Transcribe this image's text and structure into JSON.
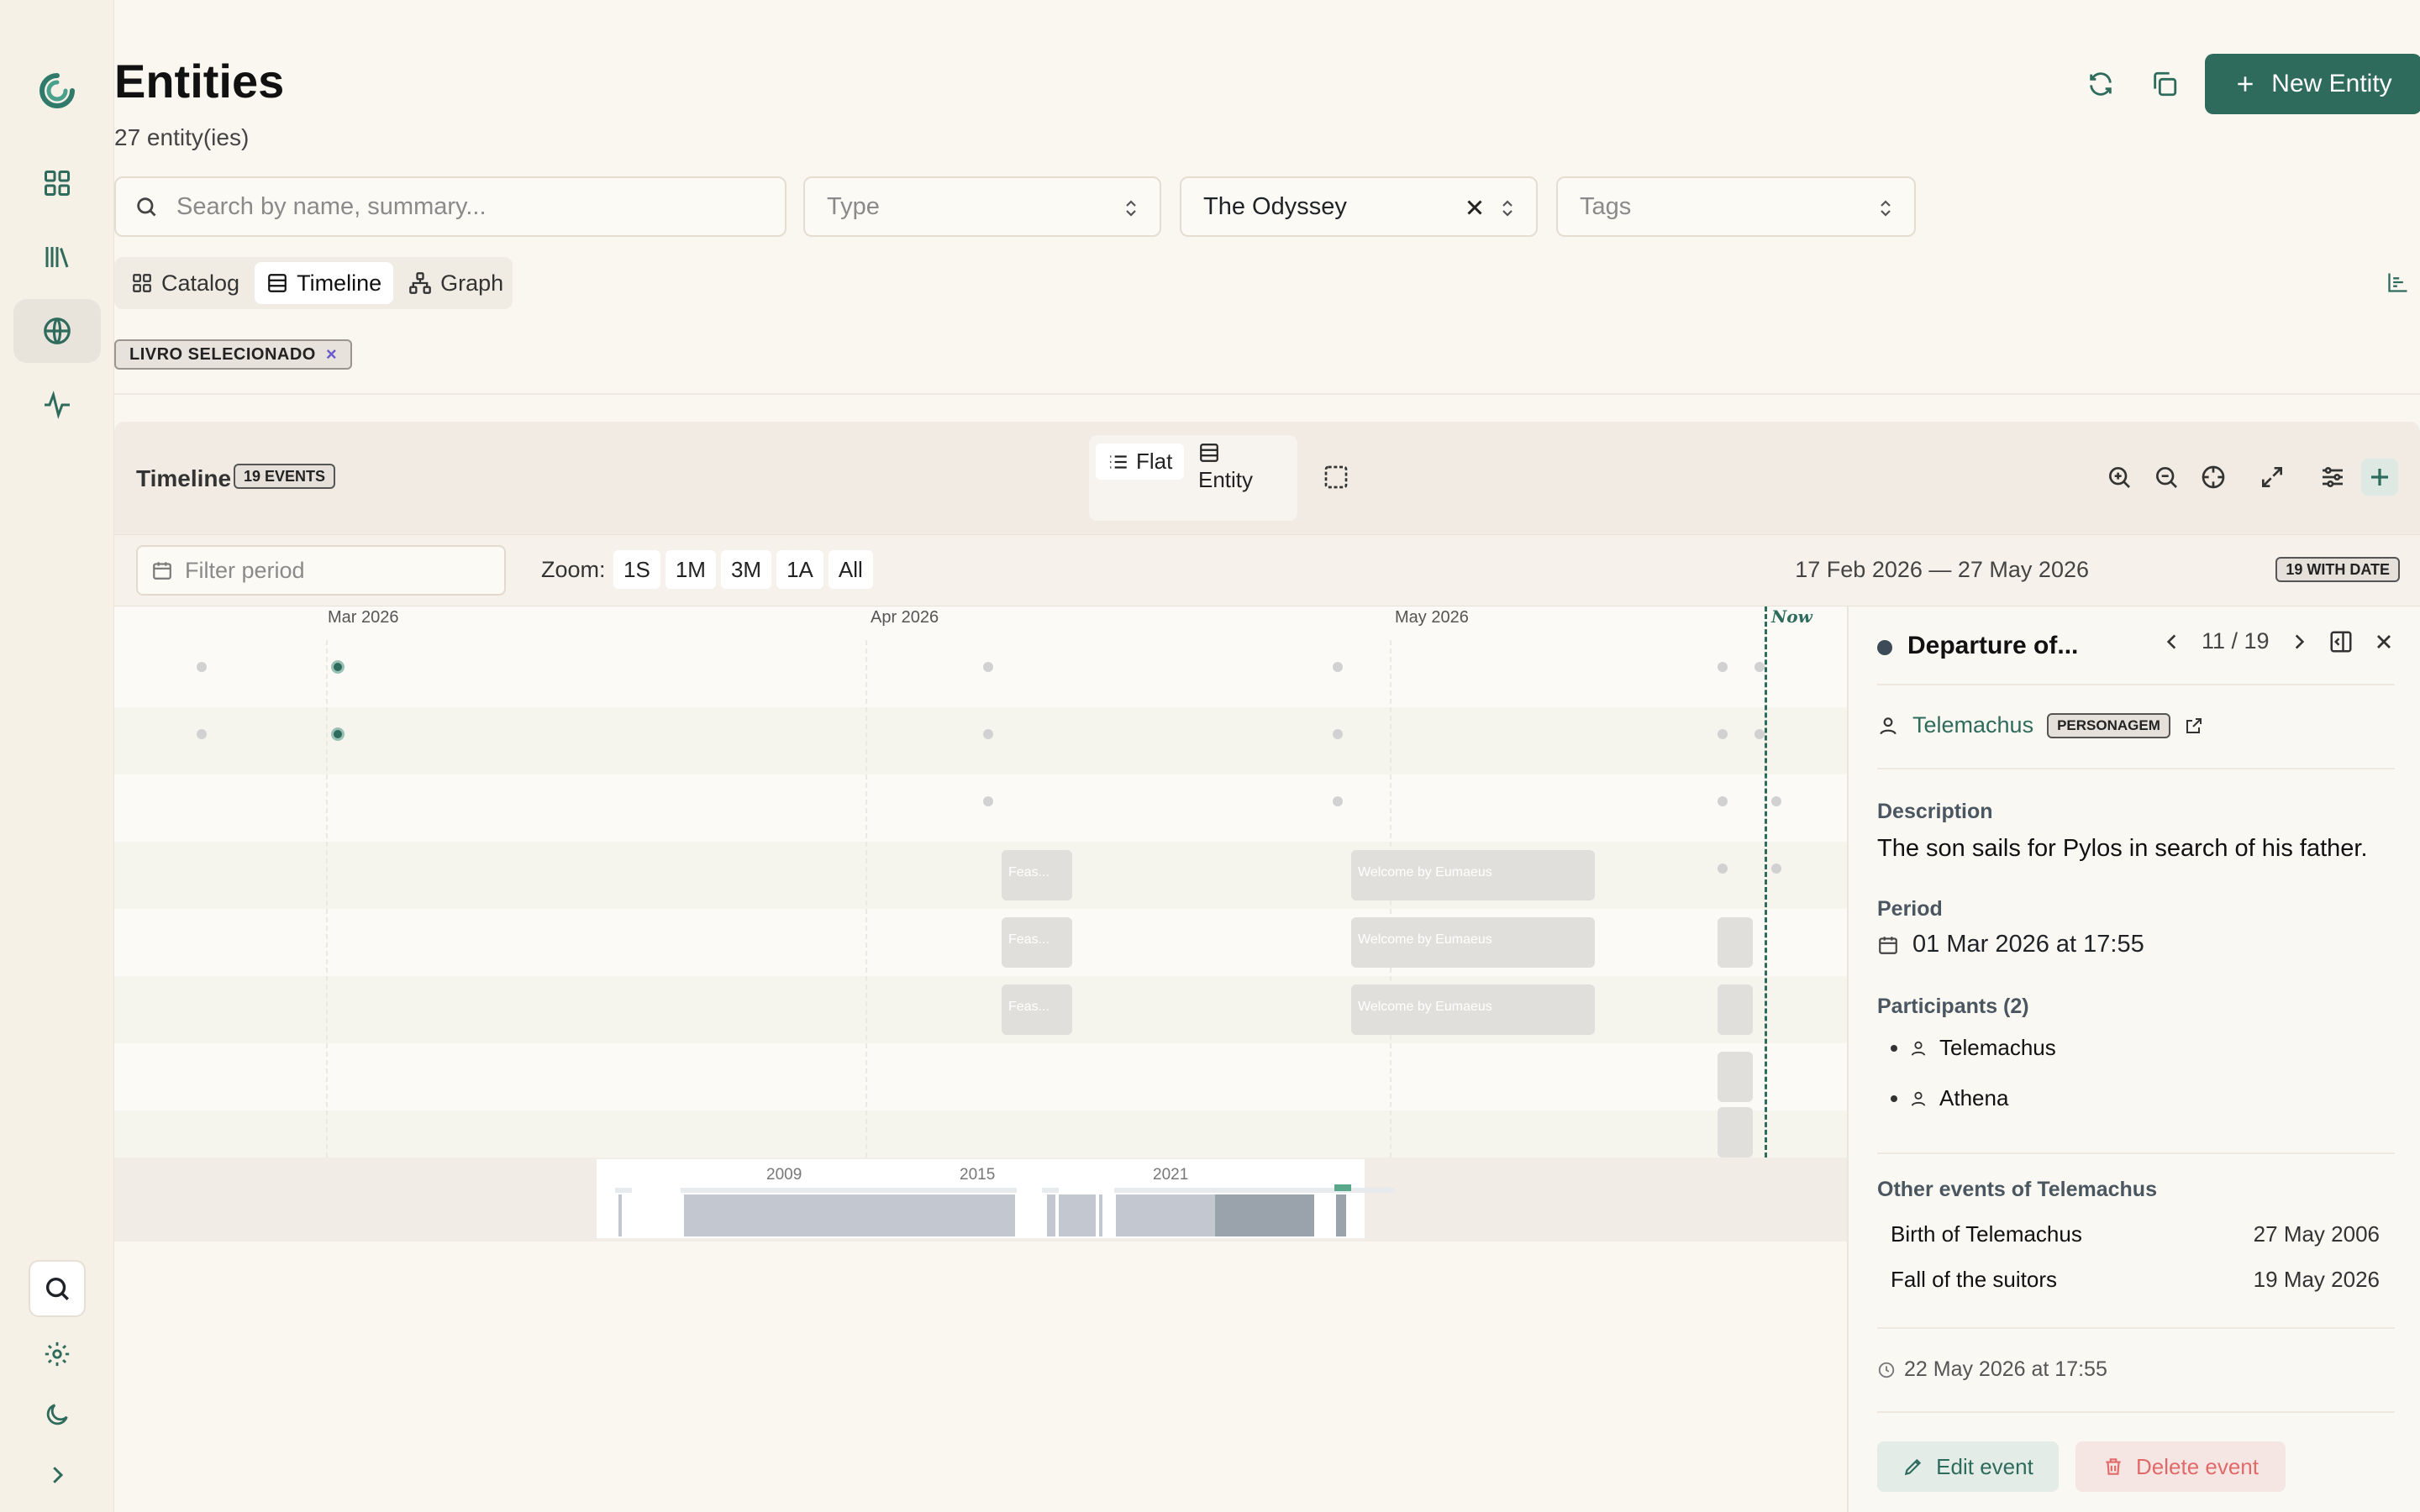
{
  "header": {
    "title": "Entities",
    "count": "27 entity(ies)",
    "new_entity_label": "New Entity"
  },
  "filters": {
    "search_placeholder": "Search by name, summary...",
    "type_placeholder": "Type",
    "book_value": "The Odyssey",
    "tags_placeholder": "Tags"
  },
  "view_tabs": [
    {
      "label": "Catalog",
      "icon": "grid-icon"
    },
    {
      "label": "Timeline",
      "icon": "list-icon",
      "active": true
    },
    {
      "label": "Graph",
      "icon": "graph-icon"
    }
  ],
  "chip": {
    "label": "LIVRO SELECIONADO"
  },
  "timeline": {
    "title": "Timeline",
    "events_badge": "19 EVENTS",
    "mode_flat": "Flat",
    "mode_entity": "Entity",
    "filter_placeholder": "Filter period",
    "zoom_label": "Zoom:",
    "zoom_options": [
      "1S",
      "1M",
      "3M",
      "1A",
      "All"
    ],
    "range": "17 Feb 2026 — 27 May 2026",
    "with_date_badge": "19 WITH DATE",
    "months": [
      "Mar 2026",
      "Apr 2026",
      "May 2026"
    ],
    "now_label": "Now",
    "event_short": "Feas...",
    "event_long": "Welcome by Eumaeus",
    "minimap_years": [
      "2009",
      "2015",
      "2021"
    ]
  },
  "detail": {
    "title": "Departure of...",
    "position": "11 / 19",
    "entity_name": "Telemachus",
    "entity_badge": "PERSONAGEM",
    "description_label": "Description",
    "description": "The son sails for Pylos in search of his father.",
    "period_label": "Period",
    "period": "01 Mar 2026 at 17:55",
    "participants_label": "Participants (2)",
    "participants": [
      "Telemachus",
      "Athena"
    ],
    "other_events_label": "Other events of Telemachus",
    "other_events": [
      {
        "name": "Birth of Telemachus",
        "date": "27 May 2006"
      },
      {
        "name": "Fall of the suitors",
        "date": "19 May 2026"
      }
    ],
    "updated": "22 May 2026 at 17:55",
    "edit_label": "Edit event",
    "delete_label": "Delete event"
  },
  "colors": {
    "accent": "#2f6b5c",
    "danger": "#e06a6a",
    "background": "#faf7f1"
  }
}
